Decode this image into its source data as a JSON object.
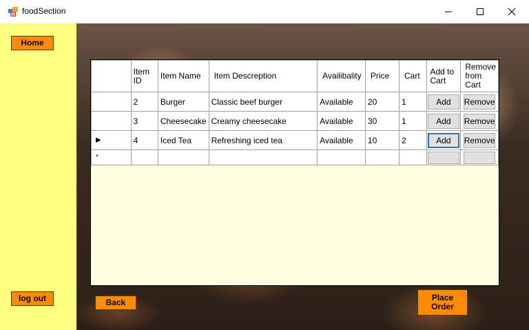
{
  "window": {
    "title": "foodSection"
  },
  "sidebar": {
    "home_label": "Home",
    "logout_label": "log out"
  },
  "grid": {
    "columns": [
      "Item ID",
      "Item Name",
      "Item Descreption",
      "Availibality",
      "Price",
      "Cart",
      "Add to Cart",
      "Remove from Cart"
    ],
    "rows": [
      {
        "id": "2",
        "name": "Burger",
        "desc": "Classic beef burger",
        "avail": "Available",
        "price": "20",
        "cart": "1",
        "add": "Add",
        "remove": "Remove"
      },
      {
        "id": "3",
        "name": "Cheesecake",
        "desc": "Creamy cheesecake",
        "avail": "Available",
        "price": "30",
        "cart": "1",
        "add": "Add",
        "remove": "Remove"
      },
      {
        "id": "4",
        "name": "Iced Tea",
        "desc": "Refreshing iced tea",
        "avail": "Available",
        "price": "10",
        "cart": "2",
        "add": "Add",
        "remove": "Remove"
      }
    ],
    "current_row_marker": "▶",
    "new_row_marker": "*"
  },
  "footer": {
    "back_label": "Back",
    "place_order_label": "Place Order"
  }
}
